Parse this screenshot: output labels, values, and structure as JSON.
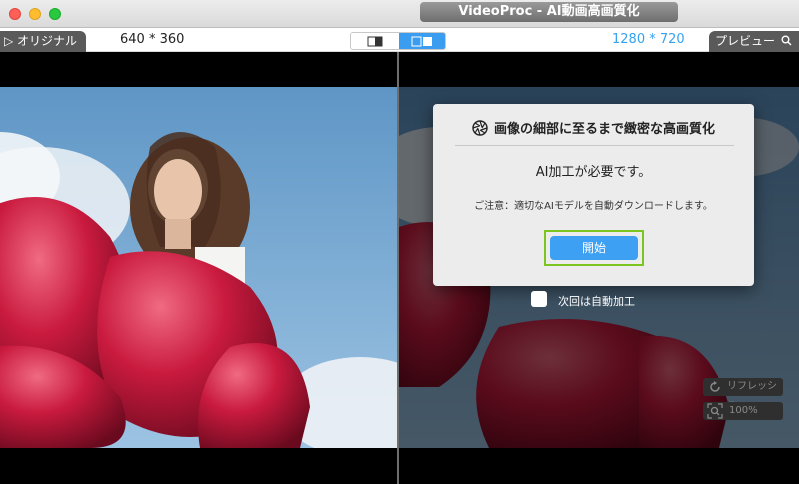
{
  "window": {
    "title": "VideoProc - AI動画高画質化"
  },
  "toolbar": {
    "original_tab": "▷ オリジナル",
    "preview_tab": "プレビュー",
    "original_resolution": "640 * 360",
    "output_resolution": "1280 * 720"
  },
  "dialog": {
    "title": "画像の細部に至るまで緻密な高画質化",
    "message": "AI加工が必要です。",
    "note": "ご注意：適切なAIモデルを自動ダウンロードします。",
    "start_button": "開始",
    "auto_checkbox_label": "次回は自動加工",
    "auto_checked": false
  },
  "controls": {
    "refresh_label": "リフレッシュ",
    "zoom_level": "100%"
  },
  "colors": {
    "accent": "#3ea0f2",
    "highlight": "#7cc41e",
    "resolution_blue": "#35a2f0"
  },
  "icons": [
    "shutter-icon",
    "search-icon",
    "refresh-icon",
    "zoom-icon",
    "split-view-icon",
    "side-by-side-icon"
  ]
}
